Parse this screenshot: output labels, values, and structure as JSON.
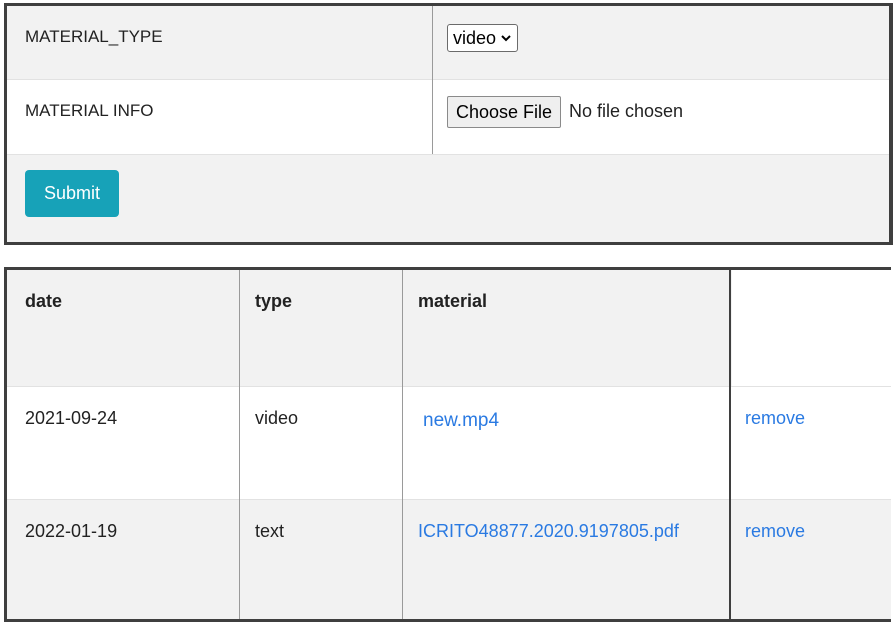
{
  "form": {
    "type_label": "MATERIAL_TYPE",
    "type_selected": "video",
    "info_label": "MATERIAL INFO",
    "file_button": "Choose File",
    "file_status": "No file chosen",
    "submit": "Submit",
    "accent": "#17a2b8"
  },
  "table": {
    "headers": [
      "date",
      "type",
      "material",
      ""
    ],
    "rows": [
      {
        "date": "2021-09-24",
        "type": "video",
        "material": "new.mp4",
        "action": "remove"
      },
      {
        "date": "2022-01-19",
        "type": "text",
        "material": "ICRITO48877.2020.9197805.pdf",
        "action": "remove"
      }
    ],
    "link_color": "#2a7ae2"
  }
}
